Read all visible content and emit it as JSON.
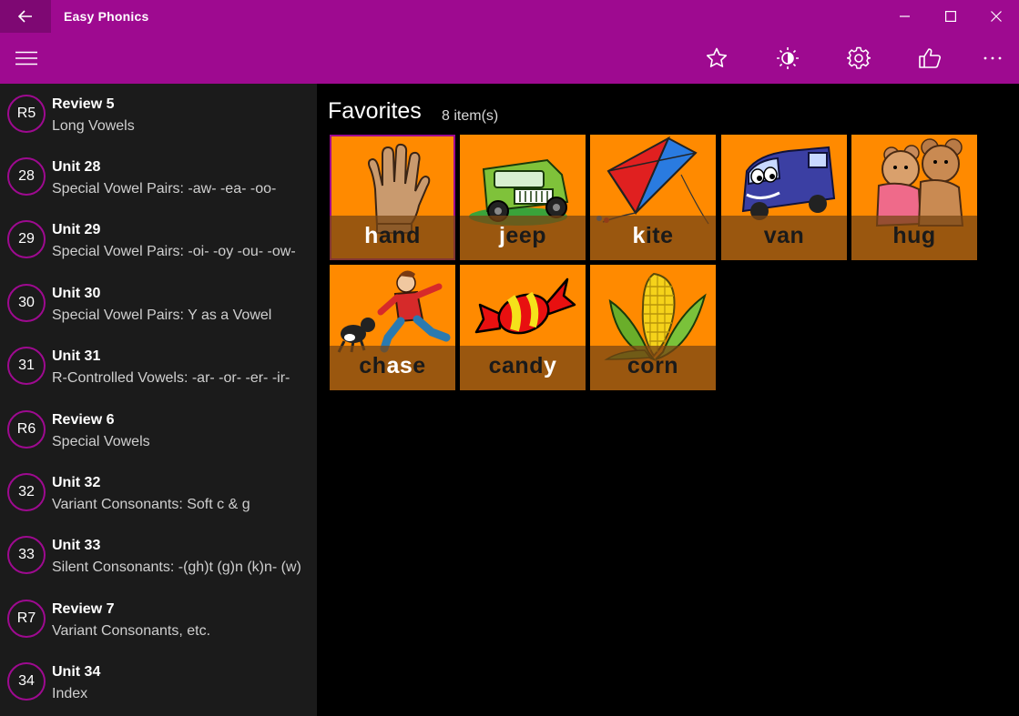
{
  "window": {
    "title": "Easy Phonics",
    "accent": "#9e0a90",
    "back_icon": "arrow-left-icon",
    "controls": [
      "minimize-icon",
      "maximize-icon",
      "close-icon"
    ]
  },
  "commandbar": {
    "menu_icon": "hamburger-icon",
    "buttons": [
      "star-icon",
      "brightness-icon",
      "gear-icon",
      "thumbs-up-icon",
      "more-icon"
    ]
  },
  "sidebar": {
    "items": [
      {
        "badge": "R5",
        "title": "Review 5",
        "subtitle": "Long Vowels"
      },
      {
        "badge": "28",
        "title": "Unit 28",
        "subtitle": "Special Vowel Pairs: -aw- -ea- -oo-"
      },
      {
        "badge": "29",
        "title": "Unit 29",
        "subtitle": "Special Vowel Pairs: -oi- -oy -ou- -ow-"
      },
      {
        "badge": "30",
        "title": "Unit 30",
        "subtitle": "Special Vowel Pairs: Y as a Vowel"
      },
      {
        "badge": "31",
        "title": "Unit 31",
        "subtitle": "R-Controlled Vowels: -ar- -or- -er- -ir-"
      },
      {
        "badge": "R6",
        "title": "Review 6",
        "subtitle": "Special Vowels"
      },
      {
        "badge": "32",
        "title": "Unit 32",
        "subtitle": "Variant Consonants: Soft c & g"
      },
      {
        "badge": "33",
        "title": "Unit 33",
        "subtitle": "Silent Consonants: -(gh)t (g)n (k)n- (w)"
      },
      {
        "badge": "R7",
        "title": "Review 7",
        "subtitle": "Variant Consonants, etc."
      },
      {
        "badge": "34",
        "title": "Unit 34",
        "subtitle": "Index"
      }
    ]
  },
  "favorites": {
    "heading": "Favorites",
    "count": "8 item(s)",
    "cards": [
      {
        "pre": "",
        "hl": "h",
        "post": "and",
        "picture": "hand"
      },
      {
        "pre": "",
        "hl": "j",
        "post": "eep",
        "picture": "jeep"
      },
      {
        "pre": "",
        "hl": "k",
        "post": "ite",
        "picture": "kite"
      },
      {
        "pre": "van",
        "hl": "",
        "post": "",
        "picture": "van"
      },
      {
        "pre": "hug",
        "hl": "",
        "post": "",
        "picture": "teddy-bears"
      },
      {
        "pre": "ch",
        "hl": "as",
        "post": "e",
        "picture": "boy-chasing-dog"
      },
      {
        "pre": "cand",
        "hl": "y",
        "post": "",
        "picture": "candy"
      },
      {
        "pre": "corn",
        "hl": "",
        "post": "",
        "picture": "corn"
      }
    ]
  }
}
